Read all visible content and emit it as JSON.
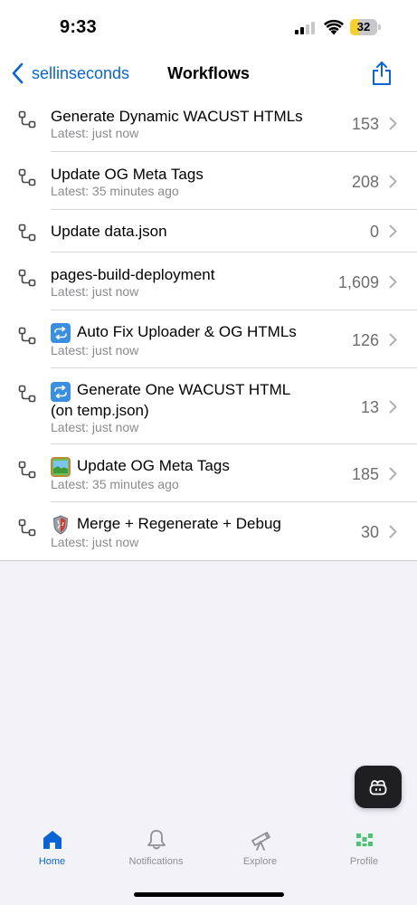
{
  "status_bar": {
    "time": "9:33",
    "battery": "32",
    "battery_level": 0.32,
    "battery_color": "#f5cf2d"
  },
  "nav": {
    "back_label": "sellinseconds",
    "title": "Workflows",
    "accent_color": "#0a64d6"
  },
  "workflows": [
    {
      "name": "Generate Dynamic WACUST HTMLs",
      "latest": "Latest: just now",
      "count": "153",
      "emoji": ""
    },
    {
      "name": "Update OG Meta Tags",
      "latest": "Latest: 35 minutes ago",
      "count": "208",
      "emoji": ""
    },
    {
      "name": "Update data.json",
      "latest": "",
      "count": "0",
      "emoji": ""
    },
    {
      "name": "pages-build-deployment",
      "latest": "Latest: just now",
      "count": "1,609",
      "emoji": ""
    },
    {
      "name": "Auto Fix Uploader & OG HTMLs",
      "latest": "Latest: just now",
      "count": "126",
      "emoji": "cycle-arrows-icon"
    },
    {
      "name": "Generate One WACUST HTML (on temp.json)",
      "latest": "Latest: just now",
      "count": "13",
      "emoji": "cycle-arrows-icon"
    },
    {
      "name": "Update OG Meta Tags",
      "latest": "Latest: 35 minutes ago",
      "count": "185",
      "emoji": "framed-picture-icon"
    },
    {
      "name": "Merge + Regenerate + Debug",
      "latest": "Latest: just now",
      "count": "30",
      "emoji": "shield-icon"
    }
  ],
  "tab_bar": {
    "tabs": [
      {
        "label": "Home",
        "icon": "home-icon",
        "active": true
      },
      {
        "label": "Notifications",
        "icon": "bell-icon",
        "active": false
      },
      {
        "label": "Explore",
        "icon": "telescope-icon",
        "active": false
      },
      {
        "label": "Profile",
        "icon": "profile-avatar-icon",
        "active": false
      }
    ]
  }
}
